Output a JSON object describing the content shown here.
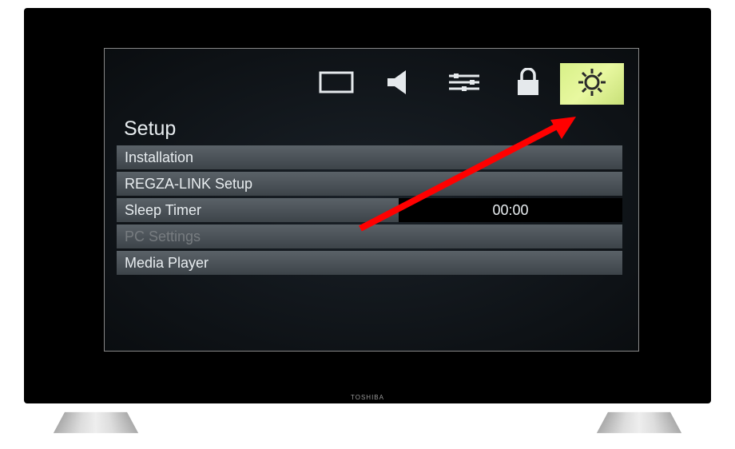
{
  "brand": "TOSHIBA",
  "tabs": [
    {
      "name": "picture",
      "icon": "display-icon"
    },
    {
      "name": "sound",
      "icon": "speaker-icon"
    },
    {
      "name": "options",
      "icon": "sliders-icon"
    },
    {
      "name": "lock",
      "icon": "lock-icon"
    },
    {
      "name": "setup",
      "icon": "gear-icon",
      "selected": true
    }
  ],
  "section_title": "Setup",
  "menu": [
    {
      "label": "Installation",
      "value": null,
      "disabled": false
    },
    {
      "label": "REGZA-LINK Setup",
      "value": null,
      "disabled": false
    },
    {
      "label": "Sleep Timer",
      "value": "00:00",
      "disabled": false
    },
    {
      "label": "PC Settings",
      "value": null,
      "disabled": true
    },
    {
      "label": "Media Player",
      "value": null,
      "disabled": false
    }
  ],
  "annotation": {
    "arrow_color": "#ff0000"
  }
}
